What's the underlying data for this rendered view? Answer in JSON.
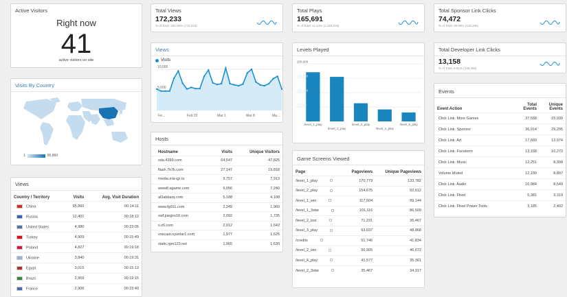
{
  "active": {
    "title": "Active Visitors",
    "right_now": "Right now",
    "count": "41",
    "label": "active visitors on site"
  },
  "country_map": {
    "title": "Visits By Country",
    "legend_min": "1",
    "legend_max": "95,860"
  },
  "views_table": {
    "title": "Views",
    "headers": [
      "Country / Territory",
      "Visits",
      "Avg. Visit Duration"
    ],
    "rows": [
      {
        "country": "China",
        "visits": "95,860",
        "duration": "00:14:11",
        "flag": "#d52b1e"
      },
      {
        "country": "Russia",
        "visits": "12,401",
        "duration": "00:18:12",
        "flag": "#3a5fb6"
      },
      {
        "country": "United States",
        "visits": "4,980",
        "duration": "00:23:05",
        "flag": "#5a6fa8"
      },
      {
        "country": "Turkey",
        "visits": "4,909",
        "duration": "00:15:49",
        "flag": "#e30a17"
      },
      {
        "country": "Poland",
        "visits": "4,827",
        "duration": "00:19:18",
        "flag": "#dc143c"
      },
      {
        "country": "Ukraine",
        "visits": "3,840",
        "duration": "00:19:31",
        "flag": "#8fb4d8"
      },
      {
        "country": "Egypt",
        "visits": "3,015",
        "duration": "00:15:13",
        "flag": "#b03030"
      },
      {
        "country": "Brazil",
        "visits": "2,959",
        "duration": "00:19:15",
        "flag": "#2e8b3a"
      },
      {
        "country": "France",
        "visits": "2,906",
        "duration": "00:23:40",
        "flag": "#4a66b0"
      }
    ]
  },
  "total_views": {
    "title": "Total Views",
    "value": "172,233",
    "sub": "% of Total: 100.00% (172,233)"
  },
  "total_plays": {
    "title": "Total Plays",
    "value": "165,691",
    "sub": "% of Total: 11.44% (1,448,219)"
  },
  "sponsor_clicks": {
    "title": "Total Sponsor Link Clicks",
    "value": "74,472",
    "sub": "% of Total: 49.89% (149,286)"
  },
  "developer_clicks": {
    "title": "Total Developer Link Clicks",
    "value": "13,158",
    "sub": "% of Total: 8.81% (149,286)"
  },
  "views_chart": {
    "title": "Views",
    "legend": "Visits",
    "color": "#1b8fd0"
  },
  "levels_chart": {
    "title": "Levels Played",
    "color": "#1a86c0"
  },
  "chart_data": [
    {
      "type": "area",
      "title": "Views",
      "series": [
        {
          "name": "Visits",
          "values": [
            5200,
            4700,
            4700,
            4700,
            7800,
            9600,
            6600,
            5200,
            5600,
            5300,
            5300,
            8300,
            9800,
            6700,
            6300,
            6500,
            10300,
            6500,
            6200,
            6000,
            6400,
            9100,
            10000,
            6900,
            6200,
            6000,
            6500,
            7700,
            8300,
            5200
          ]
        }
      ],
      "x_tick_labels": [
        "Fe...",
        "Feb 22",
        "Mar 1",
        "Mar 8",
        "Ma..."
      ],
      "y_tick_labels": [
        "10,000",
        "5,000"
      ],
      "ylim": [
        0,
        11000
      ]
    },
    {
      "type": "bar",
      "title": "Levels Played",
      "categories": [
        "/level_1_play",
        "/level_2_play",
        "/level_3_play",
        "/level_4_play",
        "/level_5_play"
      ],
      "values": [
        170779,
        154675,
        63037,
        41577,
        31000
      ],
      "y_tick_labels": [
        "200,000",
        "150,000",
        "100,000",
        "50,000"
      ],
      "ylim": [
        0,
        200000
      ]
    }
  ],
  "hosts": {
    "title": "Hosts",
    "headers": [
      "Hostname",
      "Visits",
      "Unique Visitors"
    ],
    "rows": [
      {
        "host": "sda.4399.com",
        "visits": "64,547",
        "unique": "47,825"
      },
      {
        "host": "flash.7k7k.com",
        "visits": "27,147",
        "unique": "19,818"
      },
      {
        "host": "media.era-igr.ru",
        "visits": "9,757",
        "unique": "7,913"
      },
      {
        "host": "www8.agame.com",
        "visits": "9,056",
        "unique": "7,240"
      },
      {
        "host": "al3abbarq.com",
        "visits": "5,188",
        "unique": "4,108"
      },
      {
        "host": "www.fg911.com",
        "visits": "2,249",
        "unique": "1,960"
      },
      {
        "host": "swf.juegos10.com",
        "visits": "2,092",
        "unique": "1,735"
      },
      {
        "host": "s.z6.com",
        "visits": "2,012",
        "unique": "1,642"
      },
      {
        "host": "voxcast.oyunlar1.com",
        "visits": "1,977",
        "unique": "1,625"
      },
      {
        "host": "static.igre123.net",
        "visits": "1,965",
        "unique": "1,630"
      }
    ]
  },
  "screens": {
    "title": "Game Screens Viewed",
    "headers": [
      "Page",
      "Pageviews",
      "Unique Pageviews"
    ],
    "rows": [
      {
        "page": "/level_1_play",
        "views": "170,779",
        "unique": "133,782"
      },
      {
        "page": "/level_2_play",
        "views": "154,675",
        "unique": "92,612"
      },
      {
        "page": "/level_1_win",
        "views": "117,604",
        "unique": "99,144"
      },
      {
        "page": "/level_1_3star",
        "views": "101,116",
        "unique": "86,509"
      },
      {
        "page": "/level_2_lost",
        "views": "71,231",
        "unique": "36,467"
      },
      {
        "page": "/level_3_play",
        "views": "63,037",
        "unique": "48,868"
      },
      {
        "page": "/credits",
        "views": "51,746",
        "unique": "41,834"
      },
      {
        "page": "/level_2_win",
        "views": "50,905",
        "unique": "46,672"
      },
      {
        "page": "/level_4_play",
        "views": "41,577",
        "unique": "35,361"
      },
      {
        "page": "/level_2_3star",
        "views": "35,467",
        "unique": "34,317"
      }
    ]
  },
  "events": {
    "title": "Events",
    "headers": [
      "Event Action",
      "Total Events",
      "Unique Events"
    ],
    "rows": [
      {
        "action": "Click Link: More Games",
        "total": "37,558",
        "unique": "23,939"
      },
      {
        "action": "Click Link: Sponsor",
        "total": "36,914",
        "unique": "29,295"
      },
      {
        "action": "Click Link: Art",
        "total": "17,660",
        "unique": "12,974"
      },
      {
        "action": "Click Link: Funstorm",
        "total": "13,158",
        "unique": "10,273"
      },
      {
        "action": "Click Link: Music",
        "total": "12,251",
        "unique": "8,398"
      },
      {
        "action": "Volume Muted",
        "total": "12,199",
        "unique": "8,897"
      },
      {
        "action": "Click Link: Audio",
        "total": "10,984",
        "unique": "8,549"
      },
      {
        "action": "Click Link: Flixel",
        "total": "5,381",
        "unique": "3,319"
      },
      {
        "action": "Click Link: Flixel Power Tools",
        "total": "3,185",
        "unique": "2,402"
      }
    ]
  }
}
